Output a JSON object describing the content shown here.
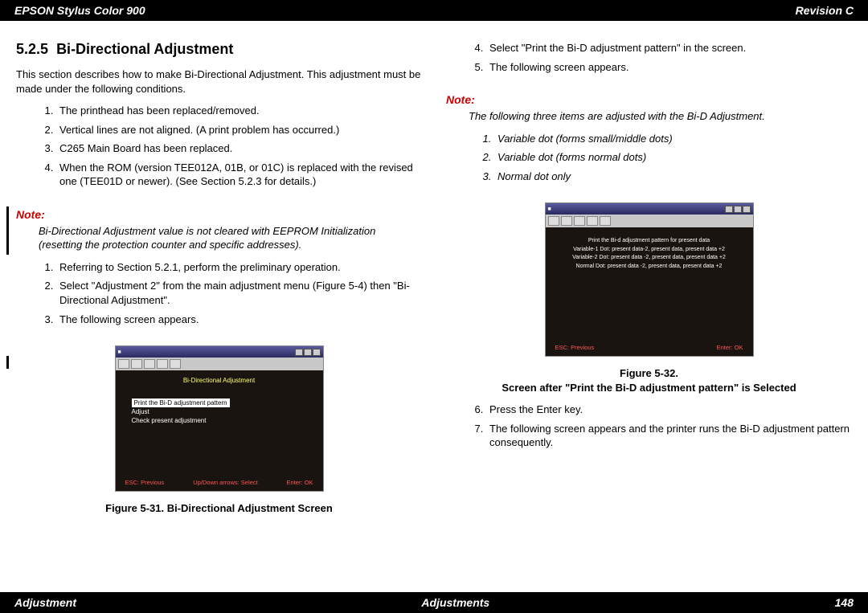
{
  "header": {
    "left": "EPSON Stylus Color 900",
    "right": "Revision C"
  },
  "footer": {
    "left": "Adjustment",
    "center": "Adjustments",
    "right": "148"
  },
  "left": {
    "sectionNum": "5.2.5",
    "sectionTitle": "Bi-Directional Adjustment",
    "intro": "This section describes how to make Bi-Directional Adjustment. This adjustment must be made under the following conditions.",
    "conditions": {
      "c1": "The printhead has been replaced/removed.",
      "c2": "Vertical lines are not aligned. (A print problem has occurred.)",
      "c3": "C265 Main Board has been replaced.",
      "c4": "When the ROM (version TEE012A, 01B, or 01C) is replaced with the revised one (TEE01D or newer). (See Section 5.2.3 for details.)"
    },
    "noteLabel": "Note:",
    "noteBody": "Bi-Directional Adjustment value is not cleared with EEPROM Initialization (resetting the protection counter and specific addresses).",
    "steps": {
      "s1": "Referring to Section 5.2.1, perform the preliminary operation.",
      "s2": "Select \"Adjustment 2\" from the main adjustment menu (Figure 5-4) then \"Bi-Directional Adjustment\".",
      "s3": "The following screen appears."
    },
    "figCaption": "Figure 5-31.  Bi-Directional Adjustment Screen",
    "ss": {
      "title": "Bi-Directional Adjustment",
      "selected": "Print the Bi-D adjustment pattern",
      "opt1": "Adjust",
      "opt2": "Check present adjustment",
      "esc": "ESC: Previous",
      "mid": "Up/Down arrows: Select",
      "enter": "Enter: OK"
    }
  },
  "right": {
    "steps1": {
      "s4": "Select \"Print the Bi-D adjustment pattern\" in the screen.",
      "s5": "The following screen appears."
    },
    "noteLabel": "Note:",
    "noteIntro": "The following three items are adjusted with the Bi-D Adjustment.",
    "noteItems": {
      "i1": "Variable dot (forms small/middle dots)",
      "i2": "Variable dot (forms normal dots)",
      "i3": "Normal dot only"
    },
    "ss": {
      "line1": "Print the Bi-d adjustment pattern for present data",
      "line2": "Variable-1 Dot: present data-2, present data, present data +2",
      "line3": "Variable-2 Dot: present data -2, present data, present data +2",
      "line4": "Normal Dot: present data -2, present data, present data +2",
      "esc": "ESC: Previous",
      "enter": "Enter: OK"
    },
    "figCaptionA": "Figure 5-32.",
    "figCaptionB": "Screen after \"Print the Bi-D adjustment pattern\" is Selected",
    "steps2": {
      "s6": "Press the Enter key.",
      "s7": "The following screen appears and the printer runs the Bi-D adjustment pattern consequently."
    }
  }
}
